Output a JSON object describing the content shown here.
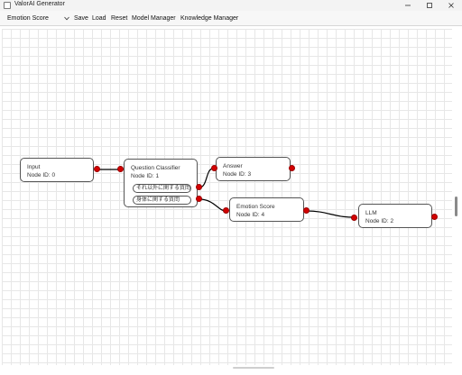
{
  "window": {
    "title": "ValorAI Generator",
    "controls": {
      "minimize_icon": "minimize-icon",
      "maximize_icon": "maximize-icon",
      "close_icon": "close-icon"
    }
  },
  "toolbar": {
    "scenario_select": {
      "value": "Emotion Score"
    },
    "save_label": "Save",
    "load_label": "Load",
    "reset_label": "Reset",
    "model_manager_label": "Model Manager",
    "knowledge_manager_label": "Knowledge Manager"
  },
  "nodes": {
    "input": {
      "title": "Input",
      "id_text": "Node ID: 0"
    },
    "question_classifier": {
      "title": "Question Classifier",
      "id_text": "Node ID: 1",
      "branches": [
        "それ以外に関する質問",
        "身体に関する質問"
      ]
    },
    "answer": {
      "title": "Answer",
      "id_text": "Node ID: 3"
    },
    "emotion_score": {
      "title": "Emotion Score",
      "id_text": "Node ID: 4"
    },
    "llm": {
      "title": "LLM",
      "id_text": "Node ID: 2"
    }
  },
  "colors": {
    "port": "#d40000",
    "edge": "#000000",
    "grid": "#e7e7e7"
  }
}
